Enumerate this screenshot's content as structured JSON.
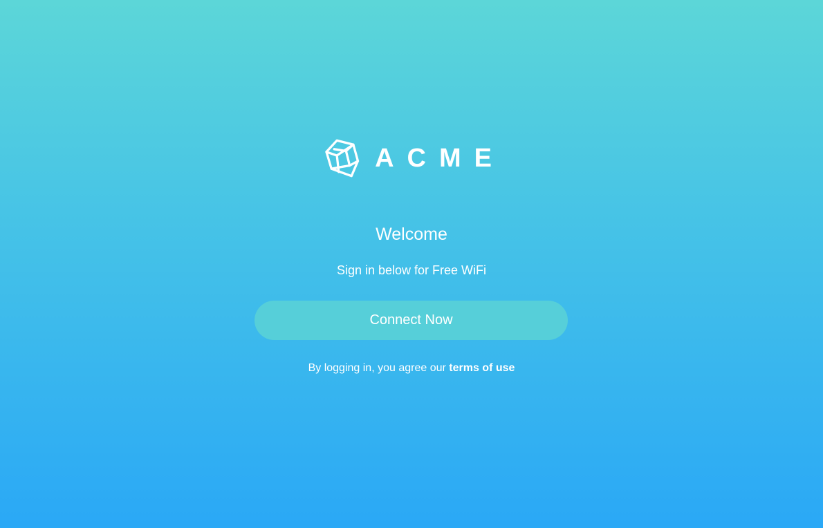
{
  "brand": {
    "name": "ACME",
    "logo_icon": "cube-icon"
  },
  "welcome": {
    "title": "Welcome",
    "subtitle": "Sign in below for Free WiFi"
  },
  "actions": {
    "connect_label": "Connect Now"
  },
  "legal": {
    "prefix": "By logging in, you agree our",
    "link_label": "terms of use"
  },
  "colors": {
    "gradient_top": "#5cd6d8",
    "gradient_bottom": "#2aa8f6",
    "button": "#56cfd9",
    "text": "#ffffff"
  }
}
